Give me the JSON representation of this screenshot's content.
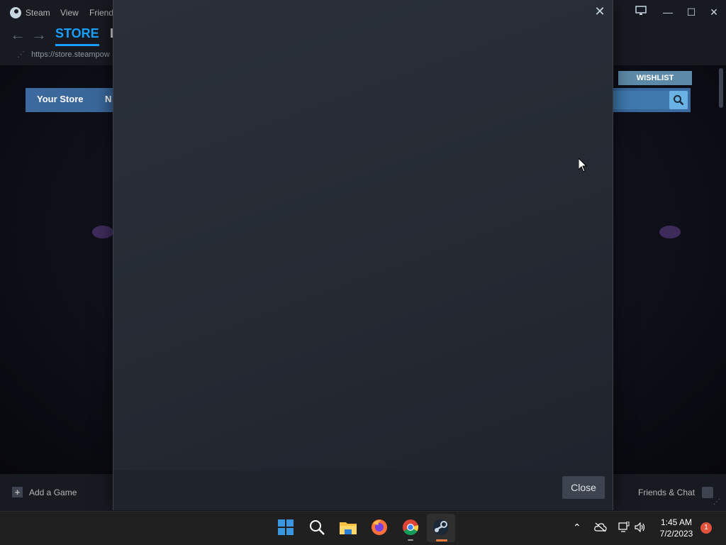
{
  "steam": {
    "menu": {
      "app": "Steam",
      "view": "View",
      "friends": "Friends"
    },
    "tabs": {
      "store": "STORE",
      "second_partial": "L"
    },
    "url": "https://store.steampow",
    "window_controls": {
      "minimize": "—",
      "maximize": "☐",
      "close": "✕"
    },
    "store_nav": {
      "your_store": "Your Store",
      "next_partial": "N"
    },
    "wishlist": "WISHLIST",
    "bottom": {
      "add_game": "Add a Game",
      "friends_chat": "Friends & Chat"
    }
  },
  "modal": {
    "close_x": "✕",
    "close_button": "Close"
  },
  "taskbar": {
    "time": "1:45 AM",
    "date": "7/2/2023",
    "notifications": "1"
  },
  "colors": {
    "steam_accent": "#1a9fff",
    "store_nav": "#3d6a9e",
    "modal_bg": "#262b34",
    "taskbar": "#202020"
  }
}
